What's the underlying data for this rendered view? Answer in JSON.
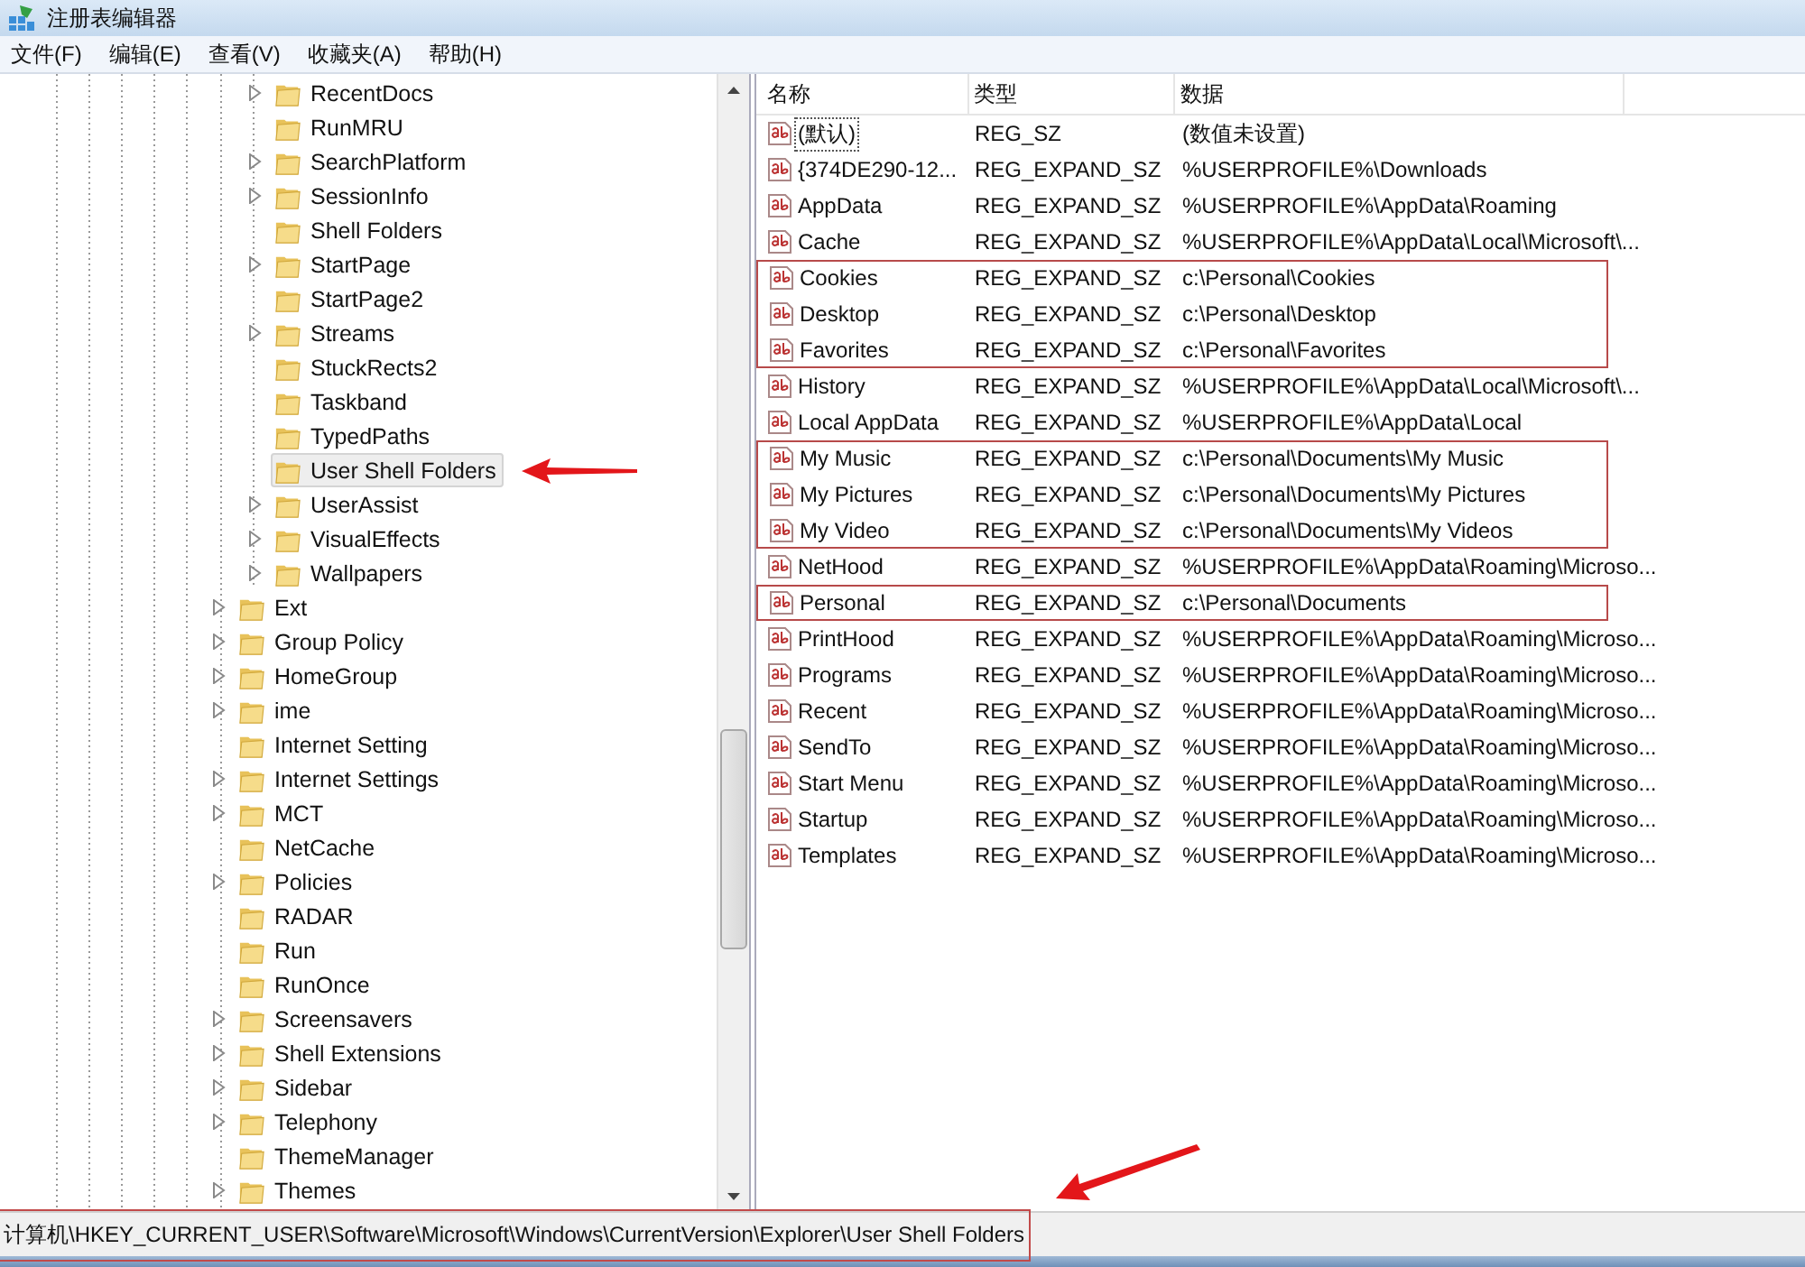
{
  "window": {
    "title": "注册表编辑器"
  },
  "menu": [
    "文件(F)",
    "编辑(E)",
    "查看(V)",
    "收藏夹(A)",
    "帮助(H)"
  ],
  "tree": {
    "items": [
      {
        "children": [
          {
            "label": "RecentDocs",
            "expandable": true,
            "selected": false
          },
          {
            "label": "RunMRU",
            "expandable": false,
            "selected": false
          },
          {
            "label": "SearchPlatform",
            "expandable": true,
            "selected": false
          },
          {
            "label": "SessionInfo",
            "expandable": true,
            "selected": false
          },
          {
            "label": "Shell Folders",
            "expandable": false,
            "selected": false
          },
          {
            "label": "StartPage",
            "expandable": true,
            "selected": false
          },
          {
            "label": "StartPage2",
            "expandable": false,
            "selected": false
          },
          {
            "label": "Streams",
            "expandable": true,
            "selected": false
          },
          {
            "label": "StuckRects2",
            "expandable": false,
            "selected": false
          },
          {
            "label": "Taskband",
            "expandable": false,
            "selected": false
          },
          {
            "label": "TypedPaths",
            "expandable": false,
            "selected": false
          },
          {
            "label": "User Shell Folders",
            "expandable": false,
            "selected": true,
            "annotated": true
          },
          {
            "label": "UserAssist",
            "expandable": true,
            "selected": false
          },
          {
            "label": "VisualEffects",
            "expandable": true,
            "selected": false
          },
          {
            "label": "Wallpapers",
            "expandable": true,
            "selected": false
          }
        ]
      },
      {
        "label": "Ext",
        "expandable": true,
        "selected": false
      },
      {
        "label": "Group Policy",
        "expandable": true,
        "selected": false
      },
      {
        "label": "HomeGroup",
        "expandable": true,
        "selected": false
      },
      {
        "label": "ime",
        "expandable": true,
        "selected": false
      },
      {
        "label": "Internet Setting",
        "expandable": false,
        "selected": false
      },
      {
        "label": "Internet Settings",
        "expandable": true,
        "selected": false
      },
      {
        "label": "MCT",
        "expandable": true,
        "selected": false
      },
      {
        "label": "NetCache",
        "expandable": false,
        "selected": false
      },
      {
        "label": "Policies",
        "expandable": true,
        "selected": false
      },
      {
        "label": "RADAR",
        "expandable": false,
        "selected": false
      },
      {
        "label": "Run",
        "expandable": false,
        "selected": false
      },
      {
        "label": "RunOnce",
        "expandable": false,
        "selected": false
      },
      {
        "label": "Screensavers",
        "expandable": true,
        "selected": false
      },
      {
        "label": "Shell Extensions",
        "expandable": true,
        "selected": false
      },
      {
        "label": "Sidebar",
        "expandable": true,
        "selected": false
      },
      {
        "label": "Telephony",
        "expandable": true,
        "selected": false
      },
      {
        "label": "ThemeManager",
        "expandable": false,
        "selected": false
      },
      {
        "label": "Themes",
        "expandable": true,
        "selected": false
      }
    ]
  },
  "table": {
    "columns": [
      "名称",
      "类型",
      "数据"
    ],
    "rows": [
      {
        "name": "(默认)",
        "type": "REG_SZ",
        "data": "(数值未设置)",
        "focused": true,
        "highlighted": false
      },
      {
        "name": "{374DE290-12...",
        "type": "REG_EXPAND_SZ",
        "data": "%USERPROFILE%\\Downloads",
        "focused": false,
        "highlighted": false
      },
      {
        "name": "AppData",
        "type": "REG_EXPAND_SZ",
        "data": "%USERPROFILE%\\AppData\\Roaming",
        "focused": false,
        "highlighted": false
      },
      {
        "name": "Cache",
        "type": "REG_EXPAND_SZ",
        "data": "%USERPROFILE%\\AppData\\Local\\Microsoft\\...",
        "focused": false,
        "highlighted": false
      },
      {
        "name": "Cookies",
        "type": "REG_EXPAND_SZ",
        "data": "c:\\Personal\\Cookies",
        "focused": false,
        "highlighted": true
      },
      {
        "name": "Desktop",
        "type": "REG_EXPAND_SZ",
        "data": "c:\\Personal\\Desktop",
        "focused": false,
        "highlighted": true
      },
      {
        "name": "Favorites",
        "type": "REG_EXPAND_SZ",
        "data": "c:\\Personal\\Favorites",
        "focused": false,
        "highlighted": true
      },
      {
        "name": "History",
        "type": "REG_EXPAND_SZ",
        "data": "%USERPROFILE%\\AppData\\Local\\Microsoft\\...",
        "focused": false,
        "highlighted": false
      },
      {
        "name": "Local AppData",
        "type": "REG_EXPAND_SZ",
        "data": "%USERPROFILE%\\AppData\\Local",
        "focused": false,
        "highlighted": false
      },
      {
        "name": "My Music",
        "type": "REG_EXPAND_SZ",
        "data": "c:\\Personal\\Documents\\My Music",
        "focused": false,
        "highlighted": true
      },
      {
        "name": "My Pictures",
        "type": "REG_EXPAND_SZ",
        "data": "c:\\Personal\\Documents\\My Pictures",
        "focused": false,
        "highlighted": true
      },
      {
        "name": "My Video",
        "type": "REG_EXPAND_SZ",
        "data": "c:\\Personal\\Documents\\My Videos",
        "focused": false,
        "highlighted": true
      },
      {
        "name": "NetHood",
        "type": "REG_EXPAND_SZ",
        "data": "%USERPROFILE%\\AppData\\Roaming\\Microso...",
        "focused": false,
        "highlighted": false
      },
      {
        "name": "Personal",
        "type": "REG_EXPAND_SZ",
        "data": "c:\\Personal\\Documents",
        "focused": false,
        "highlighted": true
      },
      {
        "name": "PrintHood",
        "type": "REG_EXPAND_SZ",
        "data": "%USERPROFILE%\\AppData\\Roaming\\Microso...",
        "focused": false,
        "highlighted": false
      },
      {
        "name": "Programs",
        "type": "REG_EXPAND_SZ",
        "data": "%USERPROFILE%\\AppData\\Roaming\\Microso...",
        "focused": false,
        "highlighted": false
      },
      {
        "name": "Recent",
        "type": "REG_EXPAND_SZ",
        "data": "%USERPROFILE%\\AppData\\Roaming\\Microso...",
        "focused": false,
        "highlighted": false
      },
      {
        "name": "SendTo",
        "type": "REG_EXPAND_SZ",
        "data": "%USERPROFILE%\\AppData\\Roaming\\Microso...",
        "focused": false,
        "highlighted": false
      },
      {
        "name": "Start Menu",
        "type": "REG_EXPAND_SZ",
        "data": "%USERPROFILE%\\AppData\\Roaming\\Microso...",
        "focused": false,
        "highlighted": false
      },
      {
        "name": "Startup",
        "type": "REG_EXPAND_SZ",
        "data": "%USERPROFILE%\\AppData\\Roaming\\Microso...",
        "focused": false,
        "highlighted": false
      },
      {
        "name": "Templates",
        "type": "REG_EXPAND_SZ",
        "data": "%USERPROFILE%\\AppData\\Roaming\\Microso...",
        "focused": false,
        "highlighted": false
      }
    ]
  },
  "status_bar": {
    "path": "计算机\\HKEY_CURRENT_USER\\Software\\Microsoft\\Windows\\CurrentVersion\\Explorer\\User Shell Folders",
    "annotated": true
  }
}
